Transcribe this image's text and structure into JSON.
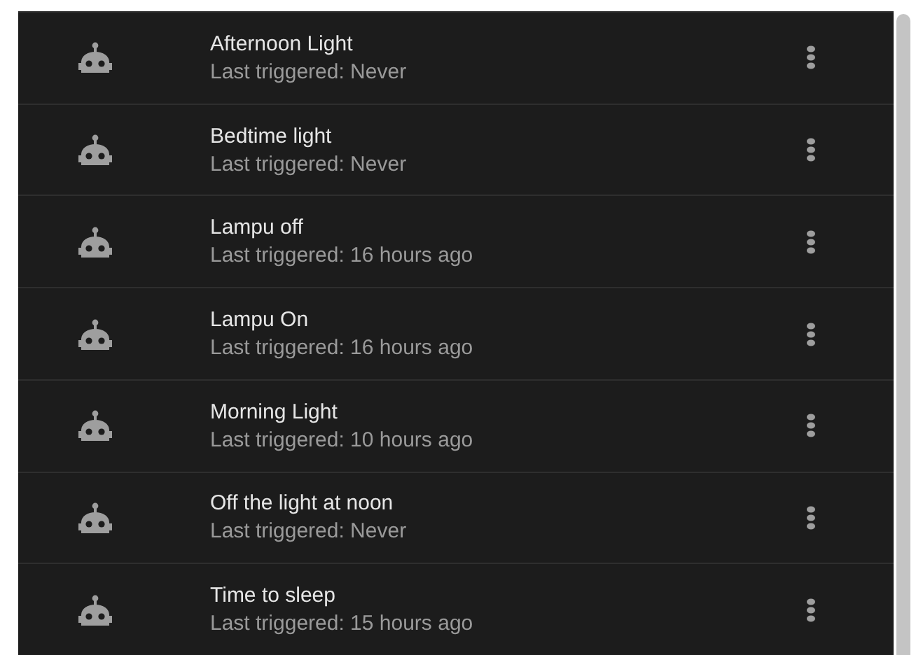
{
  "automations": [
    {
      "name": "Afternoon Light",
      "last_triggered": "Last triggered: Never"
    },
    {
      "name": "Bedtime light",
      "last_triggered": "Last triggered: Never"
    },
    {
      "name": "Lampu off",
      "last_triggered": "Last triggered: 16 hours ago"
    },
    {
      "name": "Lampu On",
      "last_triggered": "Last triggered: 16 hours ago"
    },
    {
      "name": "Morning Light",
      "last_triggered": "Last triggered: 10 hours ago"
    },
    {
      "name": "Off the light at noon",
      "last_triggered": "Last triggered: Never"
    },
    {
      "name": "Time to sleep",
      "last_triggered": "Last triggered: 15 hours ago"
    }
  ]
}
